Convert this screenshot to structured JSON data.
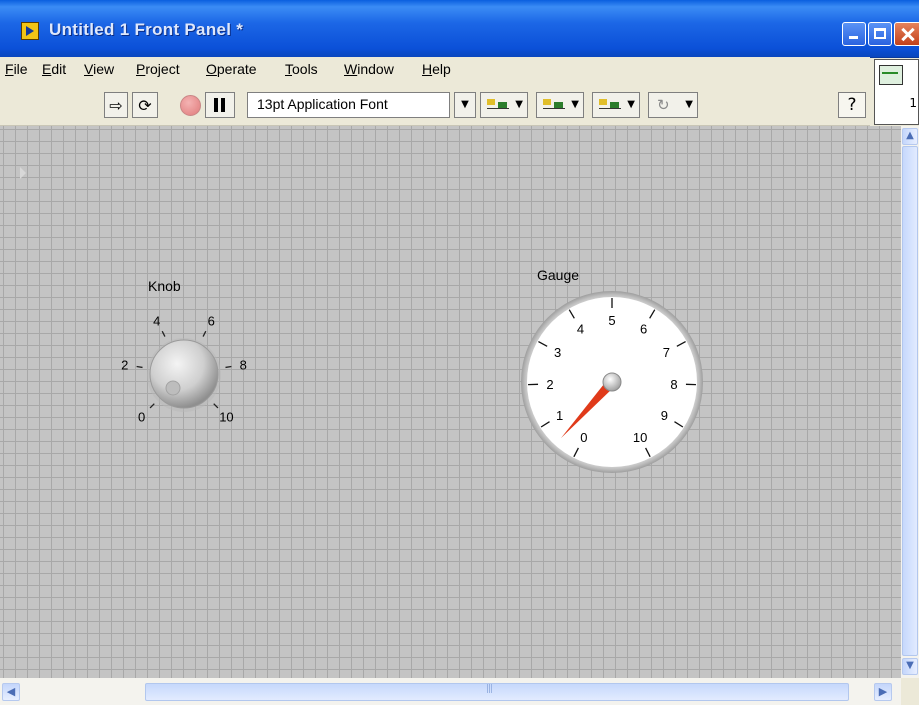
{
  "window": {
    "title": "Untitled 1 Front Panel *",
    "title_color": "#dfe8fb",
    "titlebar_color": "#0b50d8"
  },
  "menu": [
    {
      "label": "File",
      "mnemonic": "F"
    },
    {
      "label": "Edit",
      "mnemonic": "E"
    },
    {
      "label": "View",
      "mnemonic": "V"
    },
    {
      "label": "Project",
      "mnemonic": "P"
    },
    {
      "label": "Operate",
      "mnemonic": "O"
    },
    {
      "label": "Tools",
      "mnemonic": "T"
    },
    {
      "label": "Window",
      "mnemonic": "W"
    },
    {
      "label": "Help",
      "mnemonic": "H"
    }
  ],
  "toolbar": {
    "run_icon": "run-arrow-icon",
    "run_continuous_icon": "run-continuously-icon",
    "abort_icon": "abort-icon",
    "pause_icon": "pause-icon",
    "font": "13pt Application Font",
    "align_icon": "align-objects-icon",
    "distribute_icon": "distribute-objects-icon",
    "resize_icon": "resize-objects-icon",
    "reorder_icon": "reorder-icon",
    "help_icon": "context-help-icon"
  },
  "connector_pane": {
    "icon": "vi-icon",
    "number": "1"
  },
  "canvas": {
    "grid_color": "#a8a8a8",
    "background": "#c4c4c4"
  },
  "knob": {
    "label": "Knob",
    "scale": [
      "0",
      "2",
      "4",
      "6",
      "8",
      "10"
    ],
    "value": 0
  },
  "gauge": {
    "label": "Gauge",
    "scale": [
      "0",
      "1",
      "2",
      "3",
      "4",
      "5",
      "6",
      "7",
      "8",
      "9",
      "10"
    ],
    "value": 0.5,
    "needle_color": "#e03a1a"
  }
}
